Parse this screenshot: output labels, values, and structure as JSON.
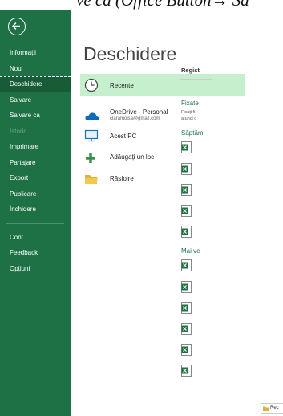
{
  "top_caption": "ve ca (Office Button→ Sa",
  "sidebar": {
    "items": [
      {
        "label": "Informații",
        "state": "normal"
      },
      {
        "label": "Nou",
        "state": "normal"
      },
      {
        "label": "Deschidere",
        "state": "active"
      },
      {
        "label": "Salvare",
        "state": "normal"
      },
      {
        "label": "Salvare ca",
        "state": "normal"
      },
      {
        "label": "Istoric",
        "state": "disabled"
      },
      {
        "label": "Imprimare",
        "state": "normal"
      },
      {
        "label": "Partajare",
        "state": "normal"
      },
      {
        "label": "Export",
        "state": "normal"
      },
      {
        "label": "Publicare",
        "state": "normal"
      },
      {
        "label": "Închidere",
        "state": "normal"
      },
      {
        "label": "Cont",
        "state": "normal"
      },
      {
        "label": "Feedback",
        "state": "normal"
      },
      {
        "label": "Opțiuni",
        "state": "normal"
      }
    ]
  },
  "main": {
    "title": "Deschidere",
    "locations": [
      {
        "label": "Recente",
        "icon": "clock-icon",
        "selected": true
      },
      {
        "label": "OneDrive - Personal",
        "sub": "claramoisa@gmail.com",
        "icon": "cloud-icon"
      },
      {
        "label": "Acest PC",
        "icon": "computer-icon"
      },
      {
        "label": "Adăugați un loc",
        "icon": "plus-icon"
      },
      {
        "label": "Răsfoire",
        "icon": "folder-icon"
      }
    ]
  },
  "recent": {
    "header": "Regist",
    "pinned_title": "Fixate",
    "pinned_desc1": "Fixați fi",
    "pinned_desc2": "atunci c",
    "week_title": "Săptăm",
    "older_title": "Mai ve",
    "browse_label": "Rec"
  },
  "colors": {
    "sidebar_bg": "#1e7145",
    "sidebar_active": "#185c37",
    "selected_bg": "#c6efce",
    "accent": "#217346"
  }
}
